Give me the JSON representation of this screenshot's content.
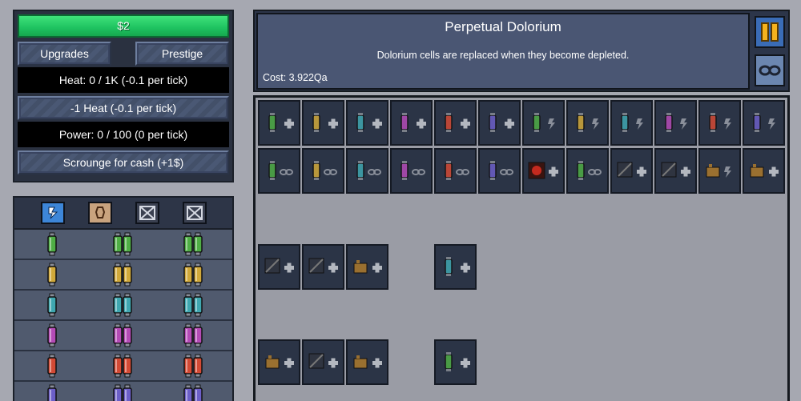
{
  "money": "$2",
  "buttons": {
    "upgrades": "Upgrades",
    "prestige": "Prestige",
    "vent": "-1 Heat (-0.1 per tick)",
    "scrounge": "Scrounge for cash (+1$)"
  },
  "stats": {
    "heat": "Heat: 0 / 1K (-0.1 per tick)",
    "power": "Power: 0 / 100 (0 per tick)"
  },
  "tabs": [
    {
      "icon": "cells-tab-icon"
    },
    {
      "icon": "resources-tab-icon"
    },
    {
      "icon": "locked-tab-icon"
    },
    {
      "icon": "locked-tab-icon"
    }
  ],
  "cell_colors": [
    "#4fae45",
    "#d1a93a",
    "#3fa7b0",
    "#b44bb6",
    "#d34a35",
    "#6c5fc8"
  ],
  "description": {
    "title": "Perpetual Dolorium",
    "text": "Dolorium cells are replaced when they become depleted.",
    "cost": "Cost: 3.922Qa"
  },
  "side_buttons": [
    {
      "icon": "pause-icon"
    },
    {
      "icon": "infinity-icon"
    }
  ],
  "upgrade_rows": [
    [
      "green",
      "yellow",
      "cyan",
      "purple",
      "red",
      "violet",
      "green",
      "yellow",
      "cyan",
      "purple",
      "red",
      "violet"
    ],
    [
      "green",
      "yellow",
      "cyan",
      "purple",
      "red",
      "violet",
      "red-heater",
      "green",
      "grey",
      "grey",
      "ore",
      "ore"
    ]
  ],
  "accent": "#3fe27a"
}
